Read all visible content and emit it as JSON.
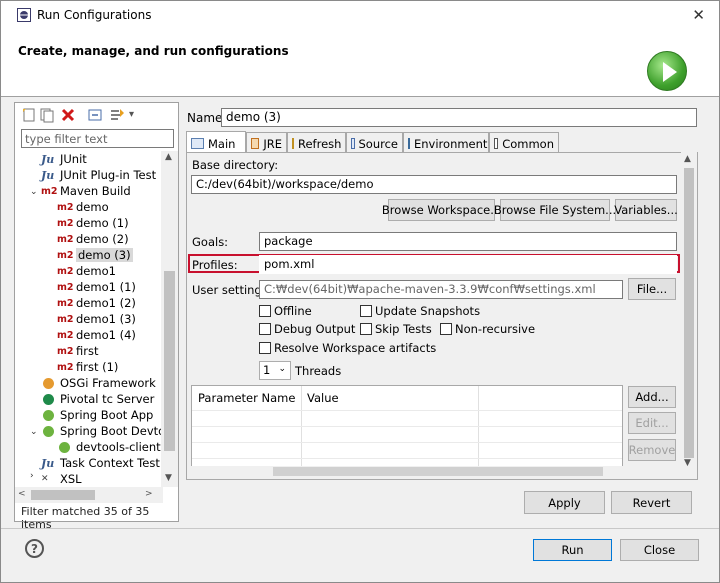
{
  "window": {
    "title": "Run Configurations",
    "banner_title": "Create, manage, and run configurations"
  },
  "left": {
    "filter_placeholder": "type filter text",
    "tree": [
      {
        "icon": "junit-icon",
        "label": "JUnit"
      },
      {
        "icon": "junit-plugin-icon",
        "label": "JUnit Plug-in Test"
      },
      {
        "icon": "maven-icon",
        "label": "Maven Build"
      },
      {
        "icon": "maven-icon",
        "label": "demo"
      },
      {
        "icon": "maven-icon",
        "label": "demo (1)"
      },
      {
        "icon": "maven-icon",
        "label": "demo (2)"
      },
      {
        "icon": "maven-icon",
        "label": "demo (3)"
      },
      {
        "icon": "maven-icon",
        "label": "demo1"
      },
      {
        "icon": "maven-icon",
        "label": "demo1 (1)"
      },
      {
        "icon": "maven-icon",
        "label": "demo1 (2)"
      },
      {
        "icon": "maven-icon",
        "label": "demo1 (3)"
      },
      {
        "icon": "maven-icon",
        "label": "demo1 (4)"
      },
      {
        "icon": "maven-icon",
        "label": "first"
      },
      {
        "icon": "maven-icon",
        "label": "first (1)"
      },
      {
        "icon": "osgi-icon",
        "label": "OSGi Framework"
      },
      {
        "icon": "pivotal-icon",
        "label": "Pivotal tc Server"
      },
      {
        "icon": "spring-icon",
        "label": "Spring Boot App"
      },
      {
        "icon": "spring-icon",
        "label": "Spring Boot Devtool"
      },
      {
        "icon": "spring-icon",
        "label": "devtools-client[d"
      },
      {
        "icon": "junit-icon",
        "label": "Task Context Test"
      },
      {
        "icon": "xsl-icon",
        "label": "XSL"
      }
    ],
    "status": "Filter matched 35 of 35 items"
  },
  "main": {
    "name_label": "Name:",
    "name_value": "demo (3)",
    "tabs": [
      {
        "label": "Main",
        "icon": "main-tab-icon"
      },
      {
        "label": "JRE",
        "icon": "jre-tab-icon"
      },
      {
        "label": "Refresh",
        "icon": "refresh-tab-icon"
      },
      {
        "label": "Source",
        "icon": "source-tab-icon"
      },
      {
        "label": "Environment",
        "icon": "environment-tab-icon"
      },
      {
        "label": "Common",
        "icon": "common-tab-icon"
      }
    ],
    "base_dir_label": "Base directory:",
    "base_dir_value": "C:/dev(64bit)/workspace/demo",
    "browse_workspace": "Browse Workspace...",
    "browse_fs": "Browse File System...",
    "variables": "Variables...",
    "goals_label": "Goals:",
    "goals_value": "package",
    "profiles_label": "Profiles:",
    "profiles_value": "pom.xml",
    "user_settings_label": "User settings:",
    "user_settings_value": "C:₩dev(64bit)₩apache-maven-3.3.9₩conf₩settings.xml",
    "file_button": "File...",
    "checkboxes": {
      "offline": "Offline",
      "update_snapshots": "Update Snapshots",
      "debug_output": "Debug Output",
      "skip_tests": "Skip Tests",
      "non_recursive": "Non-recursive",
      "resolve_workspace": "Resolve Workspace artifacts"
    },
    "threads_value": "1",
    "threads_label": "Threads",
    "table_headers": [
      "Parameter Name",
      "Value"
    ],
    "add": "Add...",
    "edit": "Edit...",
    "remove": "Remove",
    "apply": "Apply",
    "revert": "Revert"
  },
  "footer": {
    "run": "Run",
    "close": "Close"
  }
}
